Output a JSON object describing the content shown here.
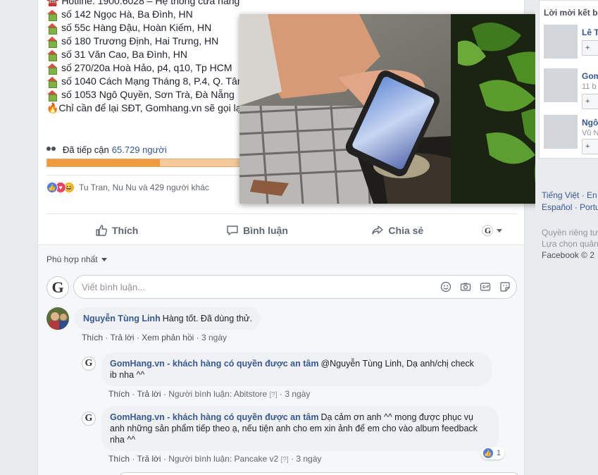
{
  "post": {
    "lines": [
      {
        "icon": "phone-icon",
        "text": "☎️ Hotline: 1900.6028 – Hệ thống cửa hàng"
      },
      {
        "icon": "house-icon",
        "text": "số 142 Ngọc Hà, Ba Đình, HN"
      },
      {
        "icon": "house-icon",
        "text": "số 55c Hàng Đậu, Hoàn Kiếm, HN"
      },
      {
        "icon": "house-icon",
        "text": "số 180 Trương Định, Hai Trưng, HN"
      },
      {
        "icon": "house-icon",
        "text": "số 31 Văn Cao, Ba Đình, HN"
      },
      {
        "icon": "house-icon",
        "text": "số 270/20a Hoà Hảo, p4, q10, Tp HCM"
      },
      {
        "icon": "house-icon",
        "text": "số 1040 Cách Mạng Tháng 8, P.4, Q. Tân"
      },
      {
        "icon": "house-icon",
        "text": "số 1053 Ngô Quyền, Sơn Trà, Đà Nẵng"
      },
      {
        "icon": "fire-icon",
        "text": "🔥Chỉ cần để lại SĐT, Gomhang.vn sẽ gọi lại"
      }
    ],
    "reach_label": "Đã tiếp cận",
    "reach_count": "65.729 người",
    "reach_fill": 0.24,
    "reactions_text": "Tu Tran, Nu Nu và 429 người khác",
    "actions": {
      "like": "Thích",
      "comment": "Bình luận",
      "share": "Chia sẻ"
    }
  },
  "comments_section": {
    "sort_label": "Phù hợp nhất",
    "composer_placeholder": "Viết bình luận...",
    "comments": [
      {
        "author": "Nguyễn Tùng Linh",
        "text": "Hàng tốt. Đã dùng thử.",
        "meta": {
          "like": "Thích",
          "reply": "Trả lời",
          "more": "Xem phản hồi",
          "time": "3 ngày"
        }
      },
      {
        "author": "GomHang.vn - khách hàng có quyền được an tâm",
        "text": "@Nguyễn Tùng Linh, Dạ anh/chị check ib nha ^^",
        "meta": {
          "like": "Thích",
          "reply": "Trả lời",
          "by": "Người bình luận: Abitstore",
          "q": "[?]",
          "time": "3 ngày"
        }
      },
      {
        "author": "GomHang.vn - khách hàng có quyền được an tâm",
        "text": "Dạ cảm ơn anh ^^ mong được phục vụ anh những sản phẩm tiếp theo ạ, nếu tiện anh cho em xin ảnh để em cho vào album feedback nha ^^",
        "meta": {
          "like": "Thích",
          "reply": "Trả lời",
          "by": "Người bình luận: Pancake v2",
          "q": "[?]",
          "time": "3 ngày"
        },
        "likes": "1"
      }
    ]
  },
  "right_column": {
    "title": "Lời mời kết bạn",
    "people": [
      {
        "name": "Lê T",
        "sub": "",
        "add": "+"
      },
      {
        "name": "Gom",
        "sub": "11 b",
        "add": "+"
      },
      {
        "name": "Ngô",
        "sub": "Vũ N",
        "add": "+"
      }
    ],
    "languages": [
      "Tiếng Việt · En",
      "Español · Portu"
    ],
    "footer": [
      "Quyền riêng tư",
      "Lựa chọn quảng",
      "Facebook © 2"
    ]
  },
  "colors": {
    "accent": "#365899",
    "bar_fill": "#f09a3e",
    "bar_bg": "#f5c99a"
  }
}
